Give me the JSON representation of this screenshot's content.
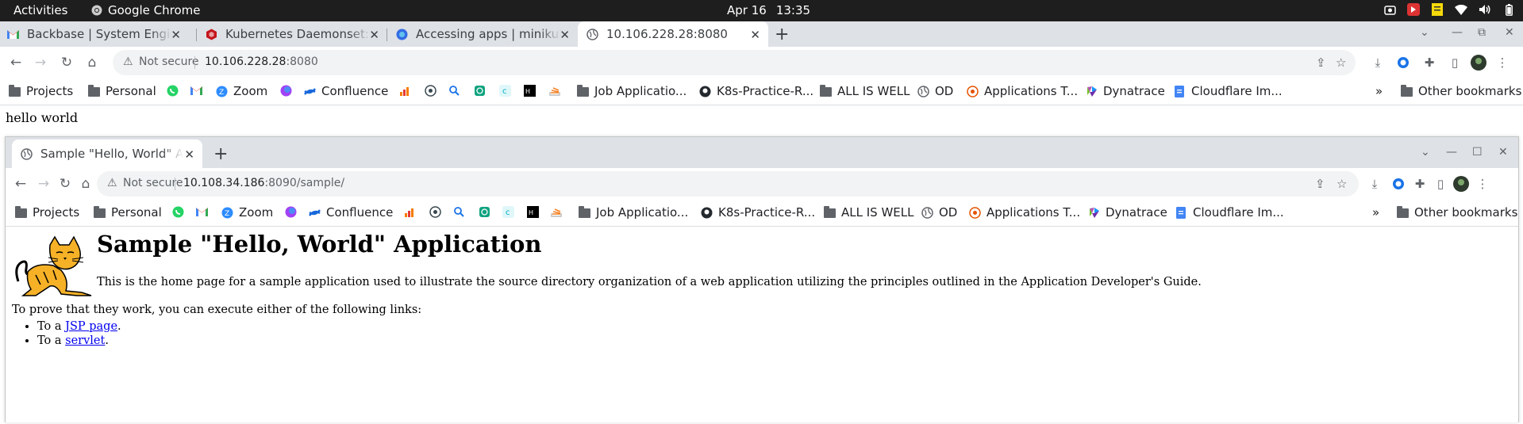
{
  "topbar": {
    "activities": "Activities",
    "app_name": "Google Chrome",
    "date": "Apr 16",
    "time": "13:35",
    "tray_icons": [
      "screenshot-icon",
      "record-icon",
      "notes-icon",
      "wifi-icon",
      "volume-icon",
      "battery-icon"
    ]
  },
  "outer_browser": {
    "tabs": [
      {
        "title": "Backbase | System Engineer",
        "icon": "gmail-icon"
      },
      {
        "title": "Kubernetes Daemonset: A",
        "icon": "red-cube-icon"
      },
      {
        "title": "Accessing apps | minikube",
        "icon": "minikube-icon"
      },
      {
        "title": "10.106.228.28:8080",
        "icon": "globe-icon",
        "active": true
      }
    ],
    "security": "Not secure",
    "url_host": "10.106.228.28",
    "url_rest": ":8080",
    "page_text": "hello world"
  },
  "bookmarks": [
    {
      "label": "Projects",
      "icon": "folder-icon"
    },
    {
      "label": "Personal",
      "icon": "folder-icon"
    },
    {
      "label": "",
      "icon": "whatsapp-icon"
    },
    {
      "label": "",
      "icon": "gmail-icon"
    },
    {
      "label": "Zoom",
      "icon": "zoom-icon"
    },
    {
      "label": "",
      "icon": "chatgpt-icon"
    },
    {
      "label": "Confluence",
      "icon": "confluence-icon"
    },
    {
      "label": "",
      "icon": "chart-icon"
    },
    {
      "label": "",
      "icon": "docker-icon"
    },
    {
      "label": "",
      "icon": "search-icon"
    },
    {
      "label": "",
      "icon": "openai-icon"
    },
    {
      "label": "",
      "icon": "c-icon"
    },
    {
      "label": "",
      "icon": "hn-icon"
    },
    {
      "label": "",
      "icon": "stack-icon"
    },
    {
      "label": "Job Applicatio...",
      "icon": "folder-icon"
    },
    {
      "label": "K8s-Practice-R...",
      "icon": "github-icon"
    },
    {
      "label": "ALL IS WELL",
      "icon": "folder-icon"
    },
    {
      "label": "OD",
      "icon": "globe-icon"
    },
    {
      "label": "Applications T...",
      "icon": "target-icon"
    },
    {
      "label": "Dynatrace",
      "icon": "dynatrace-icon"
    },
    {
      "label": "Cloudflare Im...",
      "icon": "doc-icon"
    }
  ],
  "other_bookmarks": "Other bookmarks",
  "inner_browser": {
    "tab_title": "Sample \"Hello, World\" Application",
    "security": "Not secure",
    "url_host": "10.108.34.186",
    "url_rest": ":8090/sample/"
  },
  "page": {
    "heading": "Sample \"Hello, World\" Application",
    "intro": "This is the home page for a sample application used to illustrate the source directory organization of a web application utilizing the principles outlined in the Application Developer's Guide.",
    "prove": "To prove that they work, you can execute either of the following links:",
    "links": [
      {
        "prefix": "To a ",
        "link": "JSP page",
        "suffix": "."
      },
      {
        "prefix": "To a ",
        "link": "servlet",
        "suffix": "."
      }
    ]
  },
  "colors": {
    "topbar": "#1e1e1e",
    "tabstrip": "#dee1e6",
    "omnibox": "#f1f3f4",
    "link": "#0000ee"
  }
}
